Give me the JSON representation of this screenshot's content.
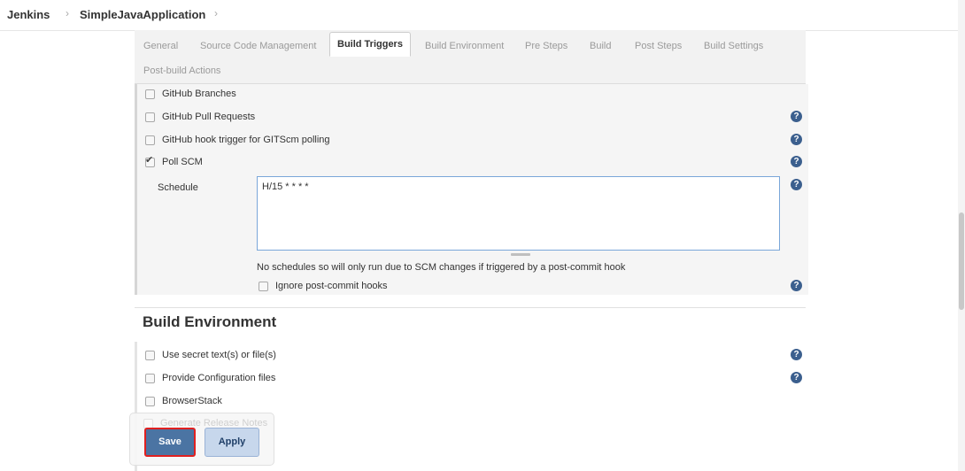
{
  "breadcrumb": {
    "items": [
      "Jenkins",
      "SimpleJavaApplication"
    ],
    "separator": "›"
  },
  "tabs": [
    {
      "label": "General",
      "active": false
    },
    {
      "label": "Source Code Management",
      "active": false
    },
    {
      "label": "Build Triggers",
      "active": true
    },
    {
      "label": "Build Environment",
      "active": false
    },
    {
      "label": "Pre Steps",
      "active": false
    },
    {
      "label": "Build",
      "active": false
    },
    {
      "label": "Post Steps",
      "active": false
    },
    {
      "label": "Build Settings",
      "active": false
    },
    {
      "label": "Post-build Actions",
      "active": false
    }
  ],
  "build_triggers": {
    "options": [
      {
        "label": "GitHub Branches",
        "checked": false,
        "help": false
      },
      {
        "label": "GitHub Pull Requests",
        "checked": false,
        "help": true
      },
      {
        "label": "GitHub hook trigger for GITScm polling",
        "checked": false,
        "help": true
      },
      {
        "label": "Poll SCM",
        "checked": true,
        "help": true
      }
    ],
    "schedule": {
      "label": "Schedule",
      "value": "H/15 * * * *",
      "hint": "No schedules so will only run due to SCM changes if triggered by a post-commit hook"
    },
    "ignore_hooks": {
      "label": "Ignore post-commit hooks",
      "checked": false
    }
  },
  "build_environment": {
    "title": "Build Environment",
    "options": [
      {
        "label": "Use secret text(s) or file(s)",
        "checked": false,
        "help": true
      },
      {
        "label": "Provide Configuration files",
        "checked": false,
        "help": true
      },
      {
        "label": "BrowserStack",
        "checked": false,
        "help": false
      },
      {
        "label": "Generate Release Notes",
        "checked": false,
        "help": false
      }
    ]
  },
  "actions": {
    "save_label": "Save",
    "apply_label": "Apply"
  },
  "help_glyph": "?",
  "colors": {
    "primary_button": "#4b74a3",
    "apply_button": "#c7d7ec",
    "highlight_border": "#e02020",
    "help_icon": "#3b5f8e"
  }
}
